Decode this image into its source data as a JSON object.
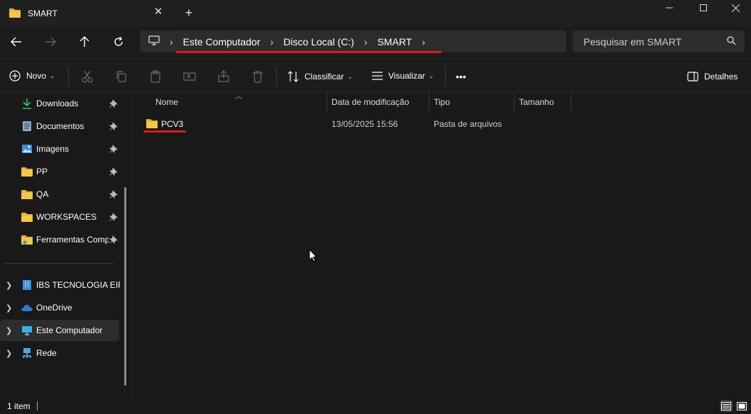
{
  "window": {
    "tab_title": "SMART",
    "tab_close": "✕",
    "new_tab": "+"
  },
  "breadcrumb": [
    "Este Computador",
    "Disco Local (C:)",
    "SMART"
  ],
  "search": {
    "placeholder": "Pesquisar em SMART"
  },
  "toolbar": {
    "new_label": "Novo",
    "sort_label": "Classificar",
    "view_label": "Visualizar",
    "more_label": "•••",
    "details_label": "Detalhes"
  },
  "sidebar": {
    "quick_access": [
      {
        "label": "Downloads",
        "icon": "download-icon"
      },
      {
        "label": "Documentos",
        "icon": "document-icon"
      },
      {
        "label": "Imagens",
        "icon": "image-icon"
      },
      {
        "label": "PP",
        "icon": "folder-icon"
      },
      {
        "label": "QA",
        "icon": "folder-icon"
      },
      {
        "label": "WORKSPACES",
        "icon": "folder-icon"
      },
      {
        "label": "Ferramentas Comp",
        "icon": "folder-icon"
      }
    ],
    "locations": [
      {
        "label": "IBS TECNOLOGIA EIRE",
        "icon": "building-icon"
      },
      {
        "label": "OneDrive",
        "icon": "cloud-icon"
      },
      {
        "label": "Este Computador",
        "icon": "computer-icon",
        "selected": true
      },
      {
        "label": "Rede",
        "icon": "network-icon"
      }
    ]
  },
  "columns": {
    "name": "Nome",
    "modified": "Data de modificação",
    "type": "Tipo",
    "size": "Tamanho"
  },
  "files": [
    {
      "name": "PCV3",
      "modified": "13/05/2025 15:56",
      "type": "Pasta de arquivos",
      "size": ""
    }
  ],
  "status": {
    "item_count": "1 item"
  },
  "colors": {
    "accent_underline": "#e0191b",
    "folder": "#f4c842",
    "background": "#191919"
  }
}
